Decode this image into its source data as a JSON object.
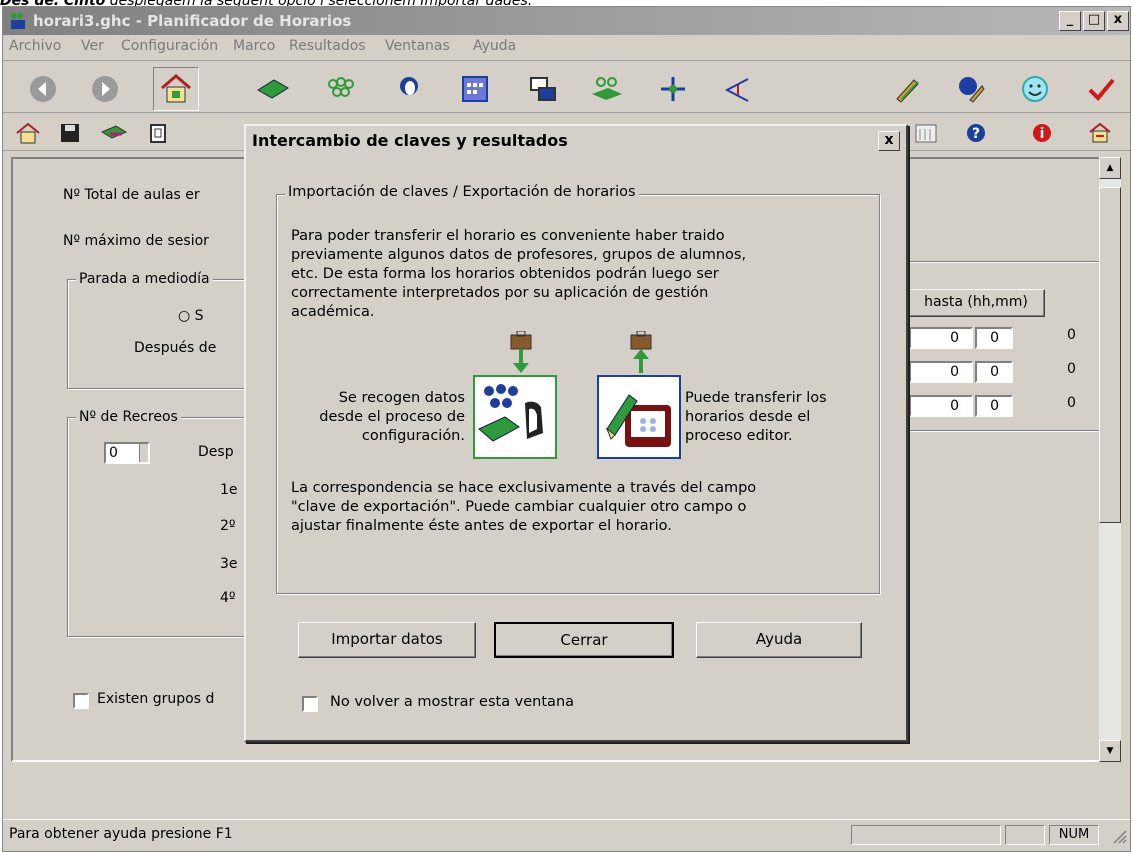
{
  "caption": {
    "prefix": "Des de:",
    "bold": "Cinto",
    "rest": "desplegaem la següent opció i seleccionem Importar dades."
  },
  "window": {
    "title": "horari3.ghc - Planificador de Horarios",
    "minimize": "_",
    "maximize": "□",
    "close": "x"
  },
  "menu": [
    "Archivo",
    "Ver",
    "Configuración",
    "Marco",
    "Resultados",
    "Ventanas",
    "Ayuda"
  ],
  "background": {
    "total_aulas_label": "Nº Total de aulas er",
    "max_sesiones_label": "Nº máximo de sesior",
    "parada_group": "Parada a mediodía",
    "radio_label": "S",
    "despues_label": "Después de",
    "recreos_group": "Nº de Recreos",
    "recreos_value": "0",
    "recreos_desp": "Desp",
    "recreo_rows": [
      "1e",
      "2º",
      "3e",
      "4º"
    ],
    "grupos_checkbox": "Existen grupos d",
    "hasta_header": "hasta (hh,mm)",
    "time_rows": [
      {
        "h": "0",
        "m": "0",
        "extra": "0"
      },
      {
        "h": "0",
        "m": "0",
        "extra": "0"
      },
      {
        "h": "0",
        "m": "0",
        "extra": "0"
      }
    ]
  },
  "status": {
    "text": "Para obtener ayuda presione F1",
    "num": "NUM"
  },
  "dialog": {
    "title": "Intercambio de claves y resultados",
    "close": "x",
    "group_title": "Importación de claves / Exportación de horarios",
    "intro": [
      "Para poder transferir el horario es conveniente haber traido",
      "previamente algunos datos de profesores, grupos de alumnos,",
      "etc. De esta forma los horarios obtenidos podrán luego ser",
      "correctamente interpretados por su aplicación de gestión",
      "académica."
    ],
    "left_text": [
      "Se recogen datos",
      "desde el proceso de",
      "configuración."
    ],
    "right_text": [
      "Puede transferir los",
      "horarios desde el",
      "proceso editor."
    ],
    "footer": [
      "La correspondencia se hace exclusivamente a través del campo",
      "\"clave de exportación\". Puede cambiar cualquier otro campo o",
      "ajustar finalmente éste antes de exportar el horario."
    ],
    "buttons": {
      "import": "Importar datos",
      "close": "Cerrar",
      "help": "Ayuda"
    },
    "checkbox_label": "No volver a mostrar esta ventana"
  },
  "colors": {
    "face": "#d4d0c8",
    "title_inactive": "#808080",
    "icon_green": "#2f9a3a",
    "icon_blue": "#1c3f9f",
    "check_red": "#d01818"
  }
}
